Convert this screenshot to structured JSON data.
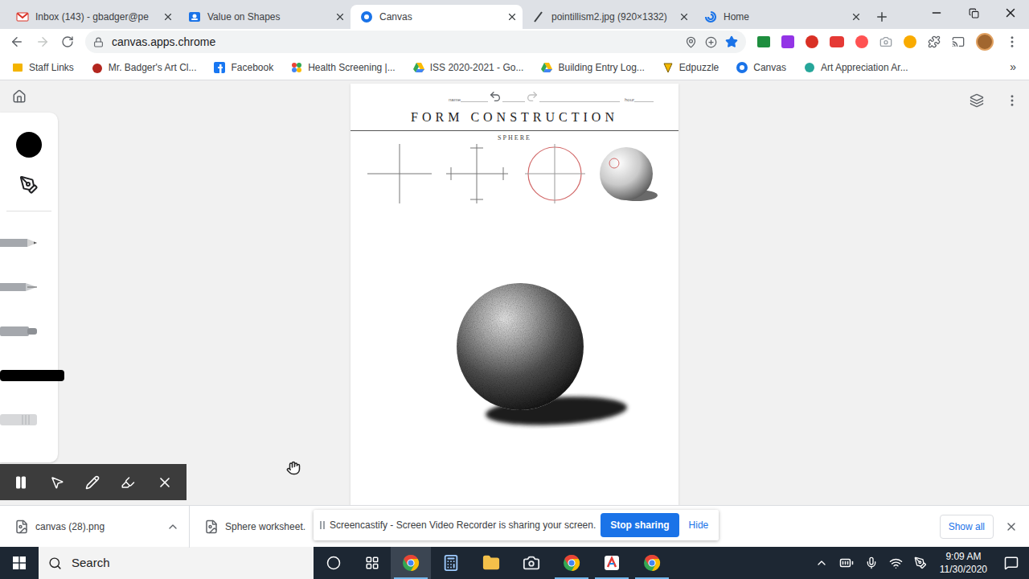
{
  "browser": {
    "tabs": [
      {
        "label": "Inbox (143) - gbadger@pe",
        "selected": false
      },
      {
        "label": "Value on Shapes",
        "selected": false
      },
      {
        "label": "Canvas",
        "selected": true
      },
      {
        "label": "pointillism2.jpg (920×1332)",
        "selected": false
      },
      {
        "label": "Home",
        "selected": false
      }
    ],
    "address": "canvas.apps.chrome",
    "bookmarks": [
      "Staff Links",
      "Mr. Badger's Art Cl...",
      "Facebook",
      "Health Screening |...",
      "ISS 2020-2021 - Go...",
      "Building Entry Log...",
      "Edpuzzle",
      "Canvas",
      "Art Appreciation Ar..."
    ],
    "bookmarks_overflow": "»"
  },
  "canvas_app": {
    "current_color": "#000000",
    "tools": [
      {
        "kind": "pencil",
        "selected": false
      },
      {
        "kind": "pen",
        "selected": false
      },
      {
        "kind": "marker",
        "selected": false
      },
      {
        "kind": "chalk",
        "selected": true
      },
      {
        "kind": "eraser",
        "selected": false
      }
    ],
    "worksheet": {
      "name_label": "name",
      "hour_label": "hour",
      "title": "FORM CONSTRUCTION",
      "subtitle": "SPHERE"
    }
  },
  "downloads": {
    "items": [
      {
        "filename": "canvas (28).png"
      },
      {
        "filename": "Sphere worksheet."
      }
    ],
    "show_all": "Show all"
  },
  "share_notice": {
    "message": "Screencastify - Screen Video Recorder is sharing your screen.",
    "stop": "Stop sharing",
    "hide": "Hide"
  },
  "taskbar": {
    "search": "Search",
    "apps": [
      {
        "kind": "chrome",
        "active": true,
        "running": true
      },
      {
        "kind": "calculator",
        "active": false,
        "running": false
      },
      {
        "kind": "explorer",
        "active": false,
        "running": false
      },
      {
        "kind": "camera",
        "active": false,
        "running": false
      },
      {
        "kind": "chrome",
        "active": false,
        "running": true
      },
      {
        "kind": "app",
        "active": false,
        "running": true
      },
      {
        "kind": "chrome",
        "active": false,
        "running": true
      }
    ],
    "time": "9:09 AM",
    "date": "11/30/2020"
  }
}
